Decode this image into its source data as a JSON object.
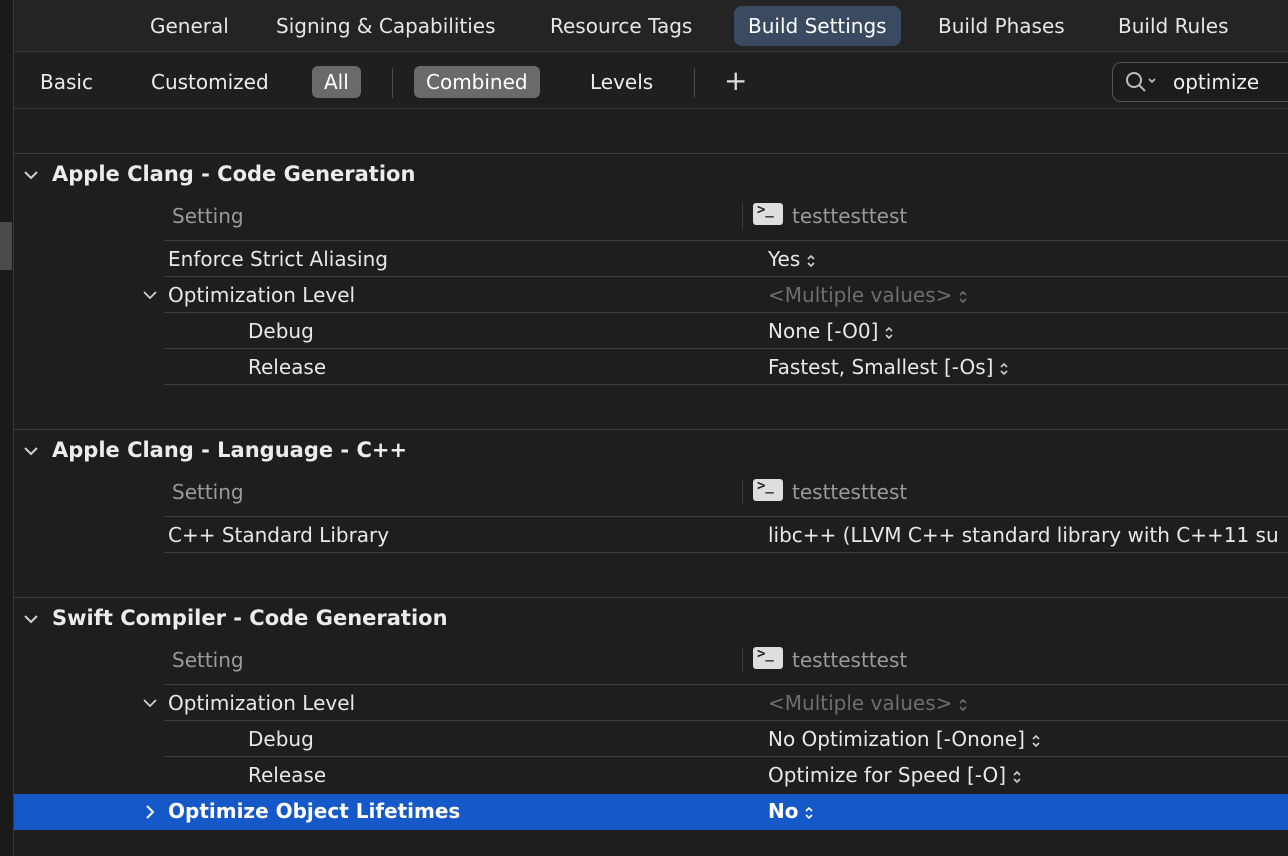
{
  "tabs": {
    "general": "General",
    "signing": "Signing & Capabilities",
    "resource_tags": "Resource Tags",
    "build_settings": "Build Settings",
    "build_phases": "Build Phases",
    "build_rules": "Build Rules"
  },
  "filter": {
    "basic": "Basic",
    "customized": "Customized",
    "all": "All",
    "combined": "Combined",
    "levels": "Levels",
    "add": "+",
    "search_value": "optimize"
  },
  "sections": {
    "clang_codegen": {
      "title": "Apple Clang - Code Generation",
      "col_setting": "Setting",
      "target": "testtesttest",
      "rows": {
        "strict_aliasing": {
          "label": "Enforce Strict Aliasing",
          "value": "Yes"
        },
        "opt_level": {
          "label": "Optimization Level",
          "value": "<Multiple values>"
        },
        "debug": {
          "label": "Debug",
          "value": "None [-O0]"
        },
        "release": {
          "label": "Release",
          "value": "Fastest, Smallest [-Os]"
        }
      }
    },
    "clang_cpp": {
      "title": "Apple Clang - Language - C++",
      "col_setting": "Setting",
      "target": "testtesttest",
      "rows": {
        "stdlib": {
          "label": "C++ Standard Library",
          "value": "libc++ (LLVM C++ standard library with C++11 su"
        }
      }
    },
    "swift_codegen": {
      "title": "Swift Compiler - Code Generation",
      "col_setting": "Setting",
      "target": "testtesttest",
      "rows": {
        "opt_level": {
          "label": "Optimization Level",
          "value": "<Multiple values>"
        },
        "debug": {
          "label": "Debug",
          "value": "No Optimization [-Onone]"
        },
        "release": {
          "label": "Release",
          "value": "Optimize for Speed [-O]"
        },
        "lifetimes": {
          "label": "Optimize Object Lifetimes",
          "value": "No"
        }
      }
    }
  },
  "colors": {
    "background": "#1e1e1e",
    "active_tab": "#3a4a60",
    "selection": "#1558c8"
  }
}
